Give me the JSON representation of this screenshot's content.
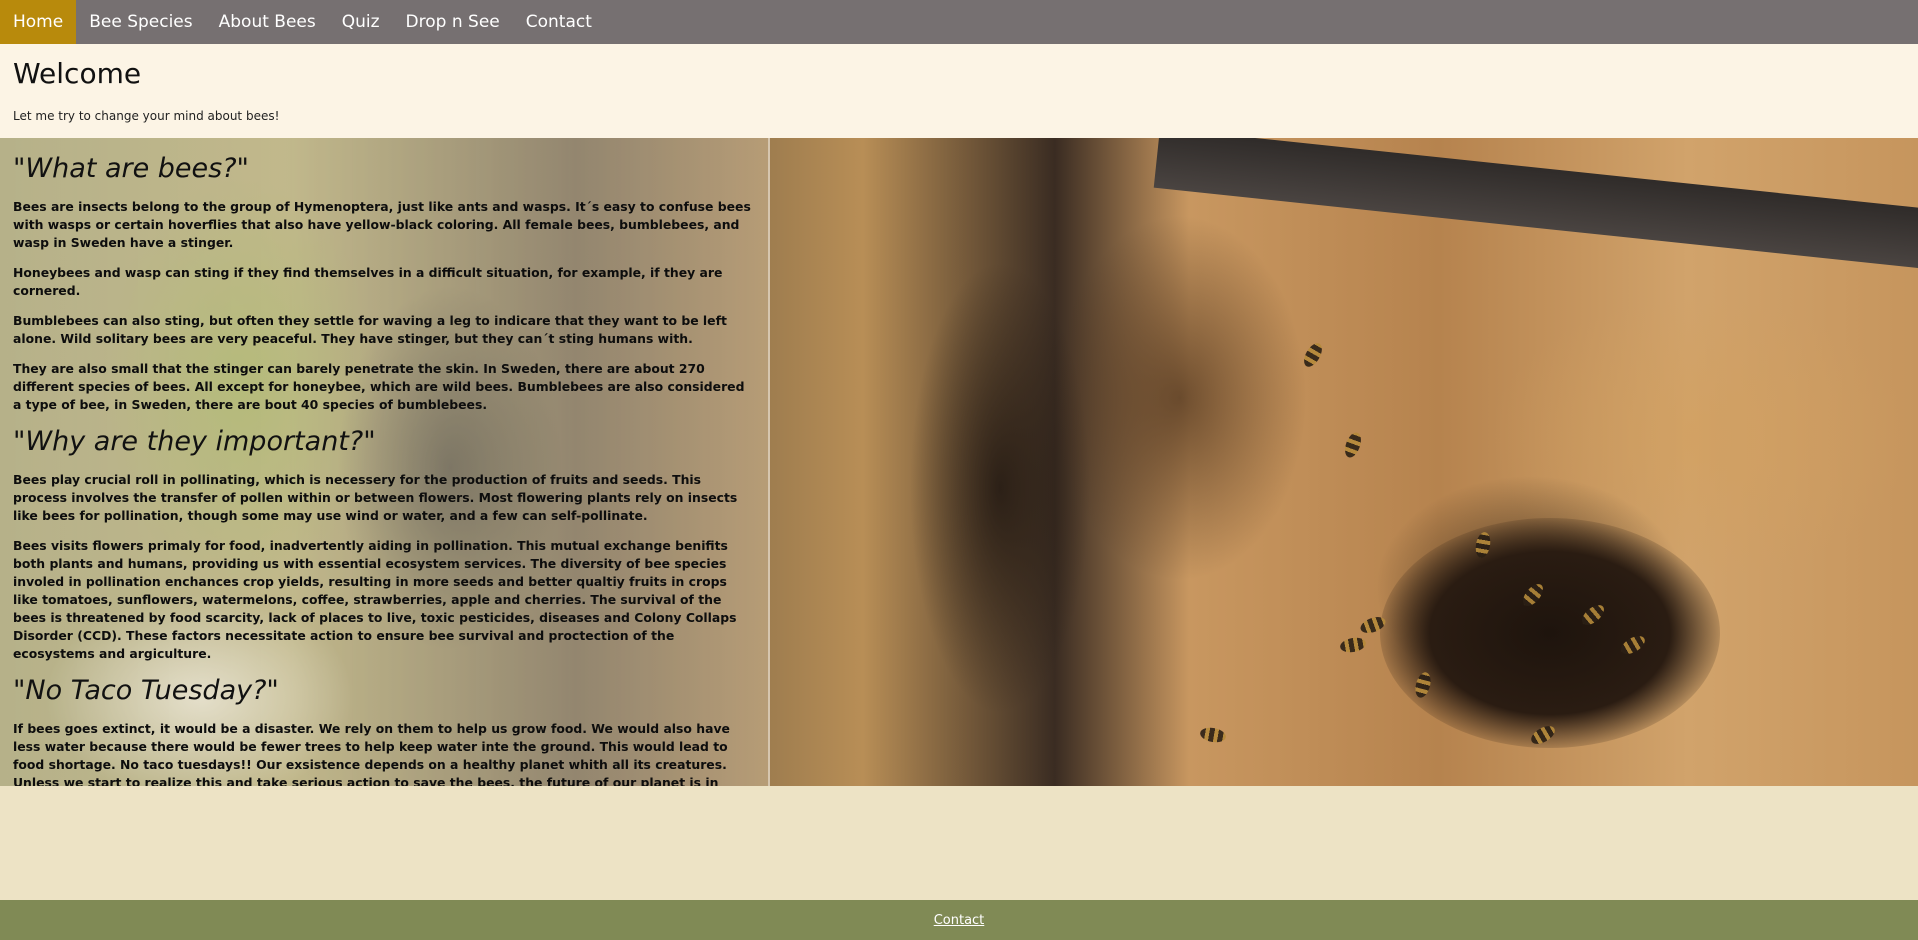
{
  "nav": {
    "items": [
      {
        "label": "Home"
      },
      {
        "label": "Bee Species"
      },
      {
        "label": "About Bees"
      },
      {
        "label": "Quiz"
      },
      {
        "label": "Drop n See"
      },
      {
        "label": "Contact"
      }
    ]
  },
  "welcome": {
    "title": "Welcome",
    "subtitle": "Let me try to change your mind about bees!"
  },
  "sections": [
    {
      "heading": "\"What are bees?\"",
      "paragraphs": [
        "Bees are insects belong to the group of Hymenoptera, just like ants and wasps. It´s easy to confuse bees with wasps or certain hoverflies that also have yellow-black coloring. All female bees, bumblebees, and wasp in Sweden have a stinger.",
        "Honeybees and wasp can sting if they find themselves in a difficult situation, for example, if they are cornered.",
        "Bumblebees can also sting, but often they settle for waving a leg to indicare that they want to be left alone. Wild solitary bees are very peaceful. They have stinger, but they can´t sting humans with.",
        "They are also small that the stinger can barely penetrate the skin. In Sweden, there are about 270 different species of bees. All except for honeybee, which are wild bees. Bumblebees are also considered a type of bee, in Sweden, there are bout 40 species of bumblebees."
      ]
    },
    {
      "heading": "\"Why are they important?\"",
      "paragraphs": [
        "Bees play crucial roll in pollinating, which is necessery for the production of fruits and seeds. This process involves the transfer of pollen within or between flowers. Most flowering plants rely on insects like bees for pollination, though some may use wind or water, and a few can self-pollinate.",
        "Bees visits flowers primaly for food, inadvertently aiding in pollination. This mutual exchange benifits both plants and humans, providing us with essential ecosystem services. The diversity of bee species involed in pollination enchances crop yields, resulting in more seeds and better qualtiy fruits in crops like tomatoes, sunflowers, watermelons, coffee, strawberries, apple and cherries. The survival of the bees is threatened by food scarcity, lack of places to live, toxic pesticides, diseases and Colony Collaps Disorder (CCD). These factors necessitate action to ensure bee survival and proctection of the ecosystems and argiculture."
      ]
    },
    {
      "heading": "\"No Taco Tuesday?\"",
      "paragraphs": [
        "If bees goes extinct, it would be a disaster. We rely on them to help us grow food. We would also have less water because there would be fewer trees to help keep water inte the ground. This would lead to food shortage. No taco tuesdays!! Our exsistence depends on a healthy planet whith all its creatures. Unless we start to realize this and take serious action to save the bees, the future of our planet is in danger."
      ]
    }
  ],
  "footer": {
    "contact_label": "Contact"
  },
  "colors": {
    "nav_bg": "#767071",
    "nav_active": "#b88a0c",
    "welcome_bg": "#fcf4e5",
    "page_bg": "#ede3c5",
    "footer_bg": "#808a55"
  }
}
